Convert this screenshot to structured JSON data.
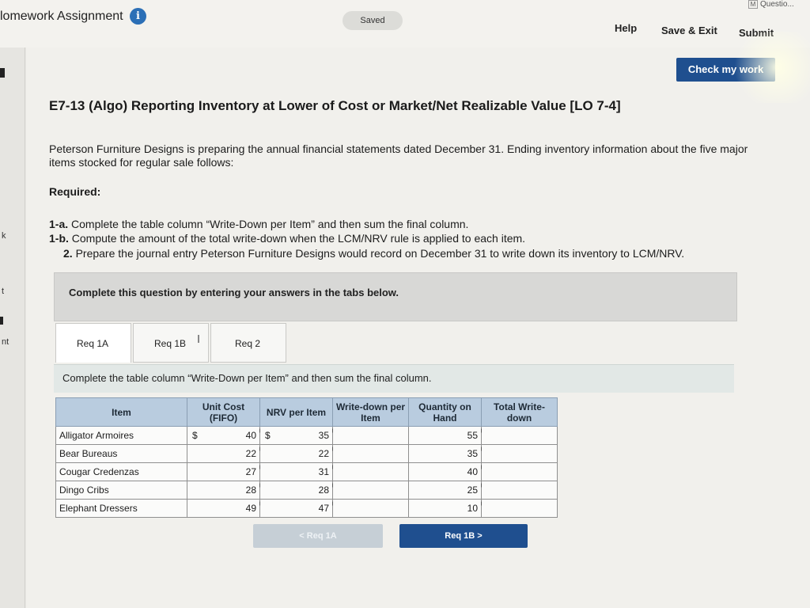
{
  "header": {
    "title": "lomework Assignment",
    "saved_label": "Saved",
    "help_label": "Help",
    "save_exit_label": "Save & Exit",
    "submit_label": "Submit",
    "question_badge": "Questio..."
  },
  "left_rail": {
    "fragments": [
      "k",
      "t",
      "nt"
    ]
  },
  "check_my_work_label": "Check my work",
  "problem": {
    "title": "E7-13 (Algo) Reporting Inventory at Lower of Cost or Market/Net Realizable Value [LO 7-4]",
    "intro": "Peterson Furniture Designs is preparing the annual financial statements dated December 31. Ending inventory information about the five major items stocked for regular sale follows:",
    "required_label": "Required:",
    "requirements": [
      {
        "tag": "1-a.",
        "text": "Complete the table column “Write-Down per Item” and then sum the final column."
      },
      {
        "tag": "1-b.",
        "text": "Compute the amount of the total write-down when the LCM/NRV rule is applied to each item."
      },
      {
        "tag": "2.",
        "text": "Prepare the journal entry Peterson Furniture Designs would record on December 31 to write down its inventory to LCM/NRV."
      }
    ]
  },
  "instructions": "Complete this question by entering your answers in the tabs below.",
  "tabs": [
    {
      "label": "Req 1A"
    },
    {
      "label": "Req 1B"
    },
    {
      "label": "Req 2"
    }
  ],
  "sub_instructions": "Complete the table column “Write-Down per Item” and then sum the final column.",
  "table": {
    "headers": [
      "Item",
      "Unit Cost (FIFO)",
      "NRV per Item",
      "Write-down per Item",
      "Quantity on Hand",
      "Total Write-down"
    ],
    "currency_symbol": "$",
    "rows": [
      {
        "item": "Alligator Armoires",
        "unit_cost": "40",
        "nrv": "35",
        "write_down": "",
        "quantity": "55",
        "total": ""
      },
      {
        "item": "Bear Bureaus",
        "unit_cost": "22",
        "nrv": "22",
        "write_down": "",
        "quantity": "35",
        "total": ""
      },
      {
        "item": "Cougar Credenzas",
        "unit_cost": "27",
        "nrv": "31",
        "write_down": "",
        "quantity": "40",
        "total": ""
      },
      {
        "item": "Dingo Cribs",
        "unit_cost": "28",
        "nrv": "28",
        "write_down": "",
        "quantity": "25",
        "total": ""
      },
      {
        "item": "Elephant Dressers",
        "unit_cost": "49",
        "nrv": "47",
        "write_down": "",
        "quantity": "10",
        "total": ""
      }
    ]
  },
  "nav": {
    "prev_label": "<  Req 1A",
    "next_label": "Req 1B  >"
  },
  "colors": {
    "accent": "#1f4f8f",
    "header_cell": "#b9ccdf",
    "info_icon": "#2b6fb6"
  }
}
